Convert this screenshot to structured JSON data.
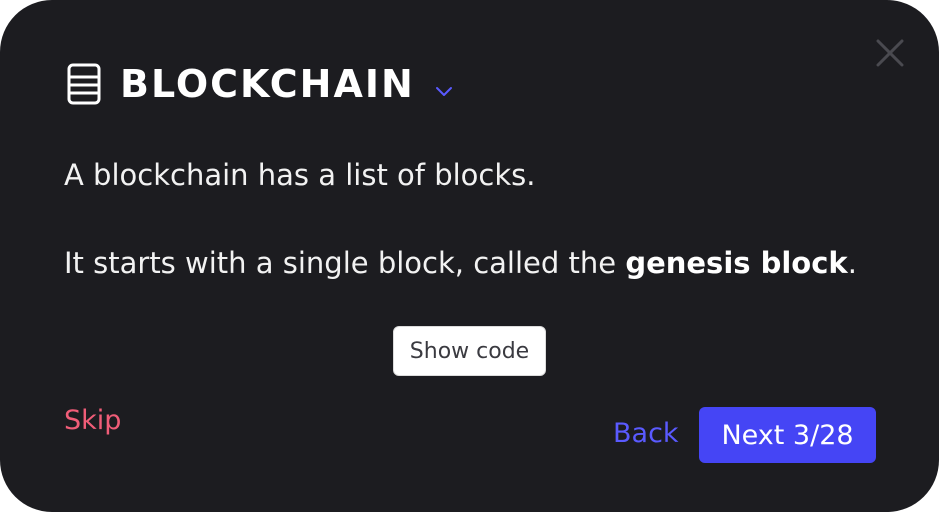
{
  "dialog": {
    "title": "BLOCKCHAIN",
    "paragraph1": "A blockchain has a list of blocks.",
    "paragraph2_prefix": "It starts with a single block, called the ",
    "paragraph2_bold": "genesis block",
    "paragraph2_suffix": ".",
    "show_code_label": "Show code",
    "skip_label": "Skip",
    "back_label": "Back",
    "next_label": "Next 3/28"
  },
  "icons": {
    "title_icon": "database-icon",
    "dropdown_icon": "chevron-down-icon",
    "close_icon": "close-icon"
  },
  "colors": {
    "background": "#1c1c20",
    "accent": "#4545f5",
    "back_link": "#5a5aff",
    "skip_link": "#f05d78",
    "close_icon": "#4a4a50"
  }
}
